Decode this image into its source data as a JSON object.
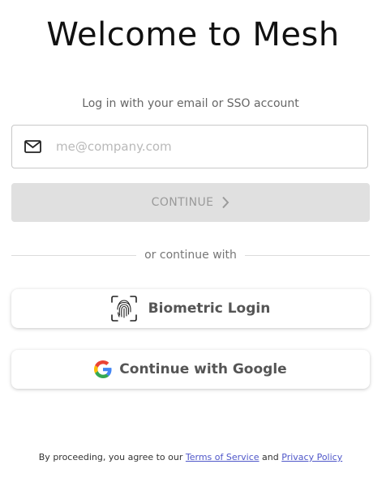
{
  "header": {
    "title": "Welcome to Mesh",
    "subtitle": "Log in with your email or SSO account"
  },
  "email": {
    "placeholder": "me@company.com",
    "value": "",
    "icon": "mail-icon"
  },
  "continue": {
    "label": "CONTINUE",
    "icon": "chevron-right-icon",
    "state": "disabled"
  },
  "divider": {
    "text": "or continue with"
  },
  "biometric": {
    "label": "Biometric Login",
    "icon": "fingerprint-icon"
  },
  "google": {
    "label": "Continue with Google",
    "icon": "google-icon"
  },
  "footer": {
    "prefix": "By proceeding, you agree to our",
    "terms": "Terms of Service",
    "and": "and",
    "privacy": "Privacy Policy"
  },
  "colors": {
    "link": "#4f57c9",
    "disabled_button": "#e0e0e0",
    "google_blue": "#4285F4",
    "google_red": "#EA4335",
    "google_yellow": "#FBBC05",
    "google_green": "#34A853"
  }
}
